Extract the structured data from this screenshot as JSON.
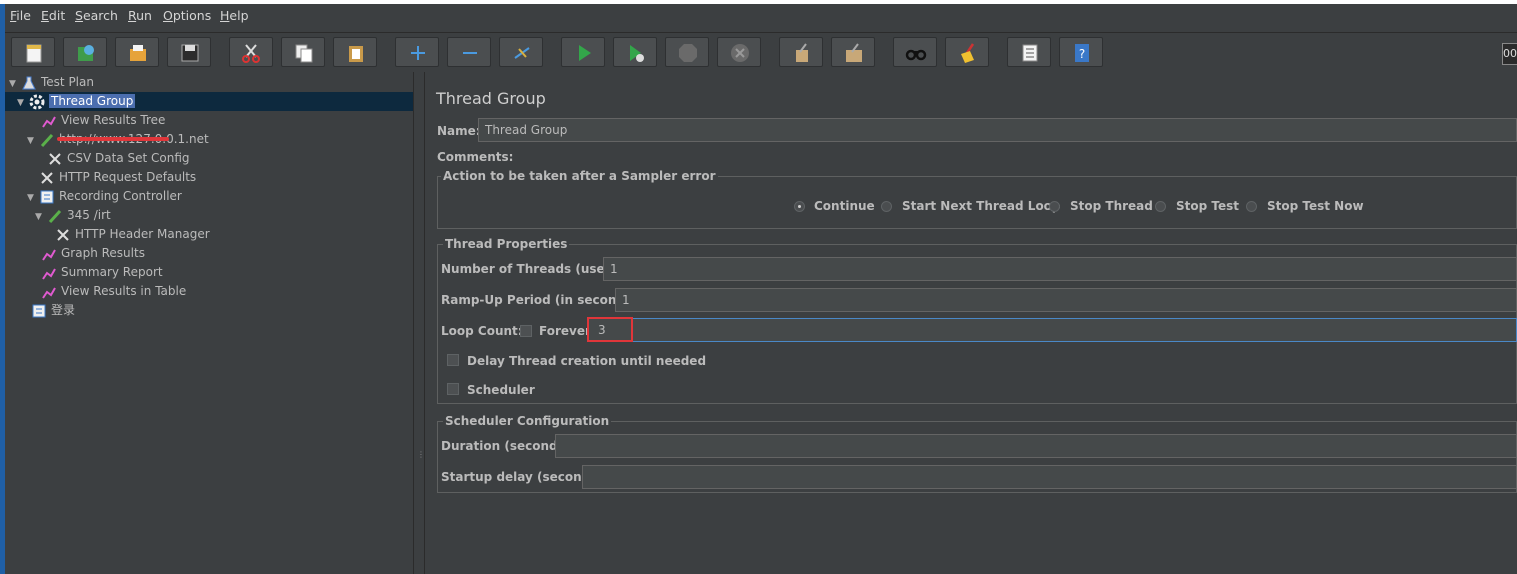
{
  "menu": [
    "File",
    "Edit",
    "Search",
    "Run",
    "Options",
    "Help"
  ],
  "toolbar": {
    "buttons": [
      "new-icon",
      "templates-icon",
      "open-icon",
      "save-icon",
      "cut-icon",
      "copy-icon",
      "paste-icon",
      "expand-icon",
      "collapse-icon",
      "toggle-icon",
      "start-icon",
      "start-no-pause-icon",
      "stop-icon",
      "shutdown-icon",
      "clear-icon",
      "clear-all-icon",
      "search-icon",
      "reset-search-icon",
      "function-helper-icon",
      "help-icon"
    ],
    "time": "00"
  },
  "tree": {
    "test_plan": "Test Plan",
    "thread_group": "Thread Group",
    "view_results_tree": "View Results Tree",
    "http_sampler_redacted": "http://www.127.0.0.1.net",
    "csv_data_set_config": "CSV Data Set Config",
    "http_request_defaults": "HTTP Request Defaults",
    "recording_controller": "Recording Controller",
    "sampler_345": "345 /irt",
    "http_header_manager": "HTTP Header Manager",
    "graph_results": "Graph Results",
    "summary_report": "Summary Report",
    "view_results_in_table": "View Results in Table",
    "login": "登录"
  },
  "panel": {
    "title": "Thread Group",
    "name_label": "Name:",
    "name_value": "Thread Group",
    "comments_label": "Comments:",
    "sampler_error": {
      "legend": "Action to be taken after a Sampler error",
      "options": [
        "Continue",
        "Start Next Thread Loop",
        "Stop Thread",
        "Stop Test",
        "Stop Test Now"
      ],
      "selected": "Continue"
    },
    "thread_properties": {
      "legend": "Thread Properties",
      "threads_label": "Number of Threads (users):",
      "threads_value": "1",
      "rampup_label": "Ramp-Up Period (in seconds):",
      "rampup_value": "1",
      "loop_label": "Loop Count:",
      "forever_label": "Forever",
      "loop_value": "3",
      "delay_label": "Delay Thread creation until needed",
      "scheduler_label": "Scheduler"
    },
    "scheduler_config": {
      "legend": "Scheduler Configuration",
      "duration_label": "Duration (seconds)",
      "duration_value": "",
      "startup_label": "Startup delay (seconds)",
      "startup_value": ""
    }
  },
  "colors": {
    "background": "#3c3f41",
    "selection": "#0d293e",
    "highlight_box": "#e0363a",
    "focus_border": "#4a88c7"
  }
}
